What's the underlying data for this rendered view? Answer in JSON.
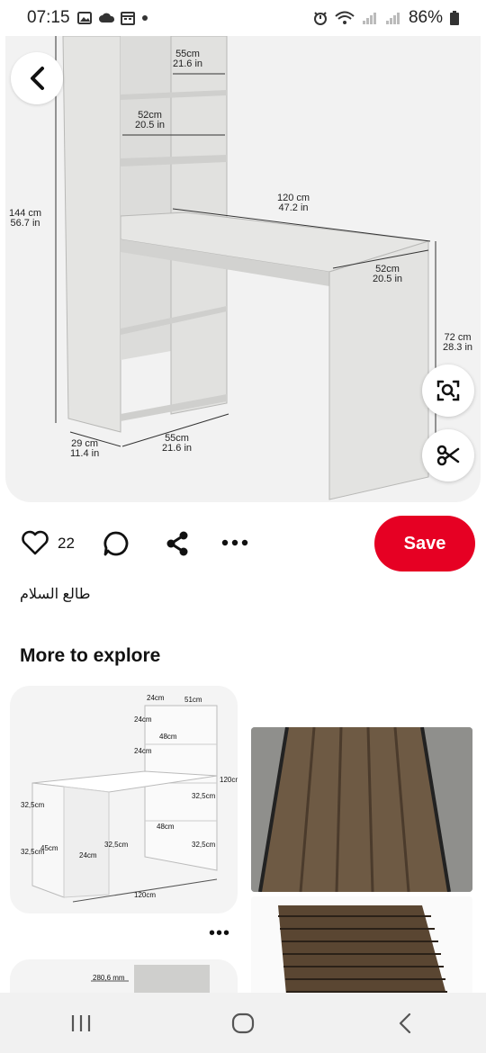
{
  "status_bar": {
    "time": "07:15",
    "battery": "86%",
    "icons": [
      "gallery-icon",
      "cloud-icon",
      "calendar-icon",
      "dot-icon",
      "alarm-icon",
      "wifi-icon",
      "signal-icon",
      "signal-icon-2",
      "battery-icon"
    ]
  },
  "pin": {
    "dimensions": {
      "top_shelf_width": [
        "55cm",
        "21.6 in"
      ],
      "shelf_width": [
        "52cm",
        "20.5 in"
      ],
      "desk_length": [
        "120 cm",
        "47.2 in"
      ],
      "height": [
        "144 cm",
        "56.7 in"
      ],
      "desk_depth": [
        "52cm",
        "20.5 in"
      ],
      "desk_height": [
        "72 cm",
        "28.3 in"
      ],
      "base_depth": [
        "29 cm",
        "11.4 in"
      ],
      "base_width": [
        "55cm",
        "21.6 in"
      ]
    },
    "buttons": {
      "back": "chevron-left-icon",
      "visual_search": "lens-search-icon",
      "cutout": "scissors-icon"
    }
  },
  "actions": {
    "like_count": "22",
    "save_label": "Save",
    "icons": [
      "heart-icon",
      "comment-icon",
      "share-icon",
      "more-icon"
    ]
  },
  "description": "طالع السلام",
  "more_to_explore": {
    "title": "More to explore",
    "card1_labels": [
      "24cm",
      "51cm",
      "24cm",
      "48cm",
      "24cm",
      "120cm",
      "32,5cm",
      "32,5cm",
      "32,5cm",
      "48cm",
      "32,5cm",
      "45cm",
      "24cm",
      "32,5cm",
      "120cm"
    ],
    "card4_label": "280,6 mm",
    "more_dots": "•••"
  },
  "nav_bar": {
    "items": [
      "recent-apps-icon",
      "home-icon",
      "back-icon"
    ]
  },
  "colors": {
    "save_red": "#e60023",
    "image_bg": "#f2f2f2"
  }
}
